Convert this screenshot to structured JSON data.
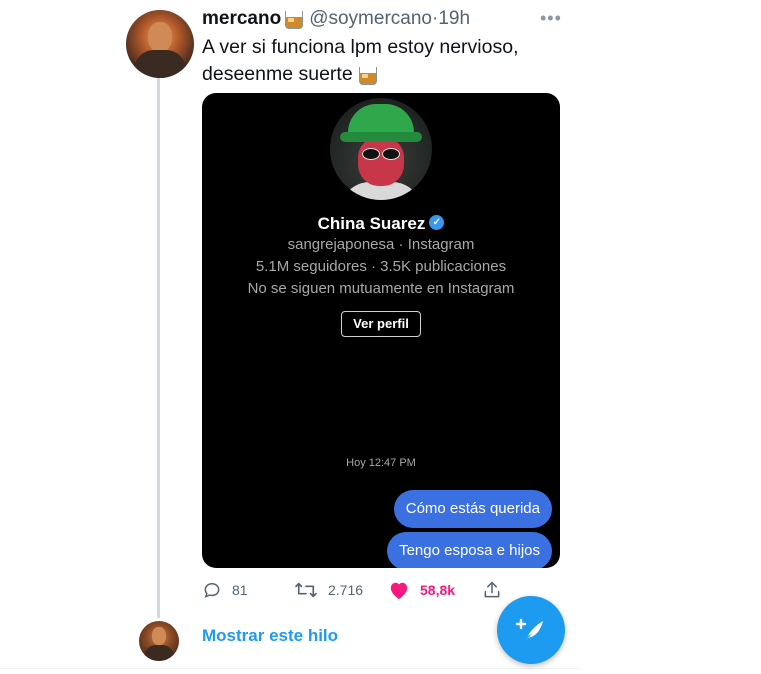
{
  "tweet": {
    "author_name": "mercano",
    "handle": "@soymercano",
    "separator": "·",
    "time": "19h",
    "more_icon": "more-horizontal-icon",
    "text": "A ver si funciona lpm estoy nervioso, deseenme suerte",
    "emoji": "tumbler-glass-emoji"
  },
  "instagram_card": {
    "profile_name": "China Suarez",
    "verified_icon": "verified-badge-icon",
    "username_line": "sangrejaponesa · Instagram",
    "stats_line": "5.1M seguidores · 3.5K publicaciones",
    "mutual_line": "No se siguen mutuamente en Instagram",
    "view_profile_label": "Ver perfil",
    "timestamp": "Hoy 12:47 PM",
    "messages": [
      "Cómo estás querida",
      "Tengo esposa e hijos"
    ]
  },
  "actions": {
    "replies": "81",
    "retweets": "2.716",
    "likes": "58,8k",
    "liked": true
  },
  "thread": {
    "show_thread_label": "Mostrar este hilo"
  },
  "colors": {
    "accent": "#1d9bf0",
    "like": "#f91880",
    "bubble": "#3a70e0",
    "card_bg": "#000000"
  }
}
